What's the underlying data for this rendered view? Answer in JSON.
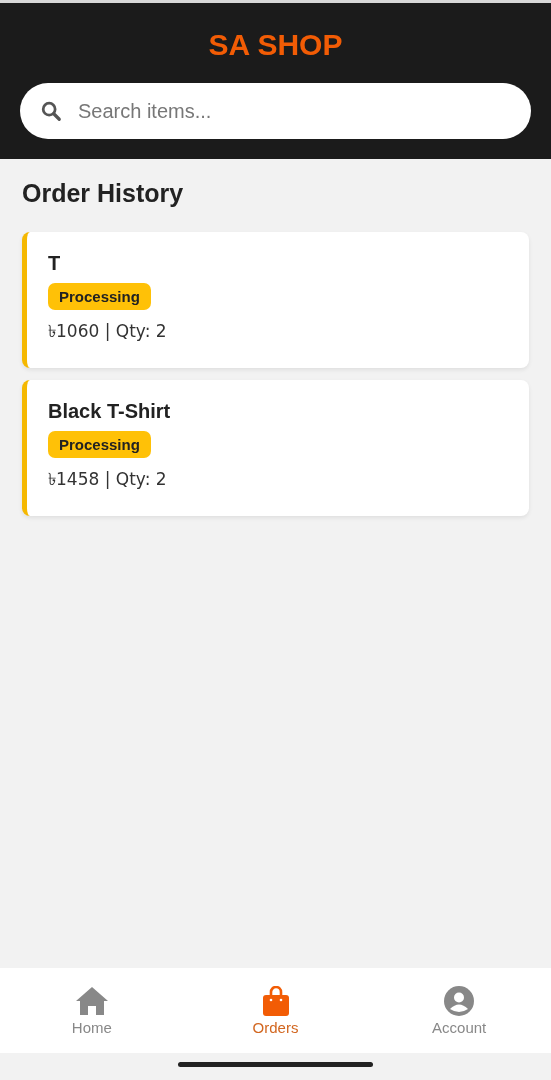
{
  "header": {
    "title": "SA SHOP"
  },
  "search": {
    "placeholder": "Search items..."
  },
  "page_title": "Order History",
  "orders": [
    {
      "name": "T",
      "status": "Processing",
      "price_qty": "৳1060 | Qty: 2"
    },
    {
      "name": "Black T-Shirt",
      "status": "Processing",
      "price_qty": "৳1458 | Qty: 2"
    }
  ],
  "nav": [
    {
      "kind": "home",
      "label": "Home",
      "selected": false
    },
    {
      "kind": "orders",
      "label": "Orders",
      "selected": true
    },
    {
      "kind": "account",
      "label": "Account",
      "selected": false
    }
  ]
}
